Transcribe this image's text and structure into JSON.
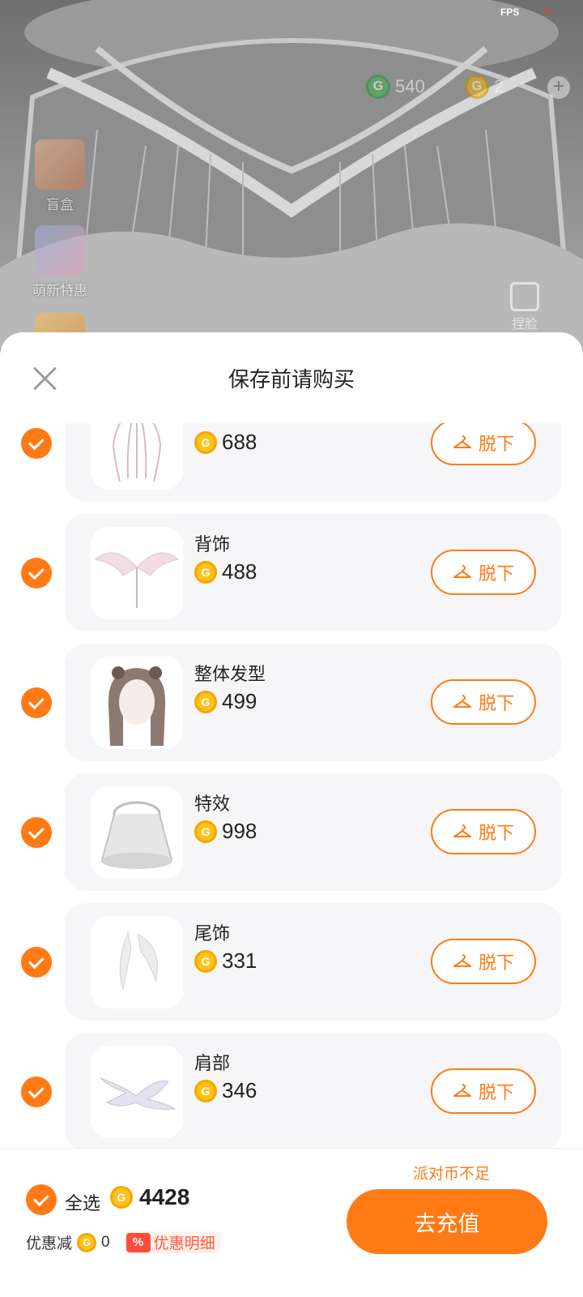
{
  "status": {
    "fps_label": "FPS",
    "fps_value": "7"
  },
  "hud": {
    "green_currency": {
      "icon": "green-coin-icon",
      "value": "540"
    },
    "gold_currency": {
      "icon": "gold-coin-icon",
      "value": "2"
    },
    "plus_symbol": "+"
  },
  "side_menu": {
    "blind_box_label": "盲盒",
    "special_offer_label": "萌新特惠",
    "right_tool_label": "捏脸"
  },
  "sheet": {
    "title": "保存前请购买",
    "items": [
      {
        "name": "",
        "price": "688",
        "action": "脱下",
        "thumb": "headdress"
      },
      {
        "name": "背饰",
        "price": "488",
        "action": "脱下",
        "thumb": "wings"
      },
      {
        "name": "整体发型",
        "price": "499",
        "action": "脱下",
        "thumb": "hair"
      },
      {
        "name": "特效",
        "price": "998",
        "action": "脱下",
        "thumb": "effect"
      },
      {
        "name": "尾饰",
        "price": "331",
        "action": "脱下",
        "thumb": "tail"
      },
      {
        "name": "肩部",
        "price": "346",
        "action": "脱下",
        "thumb": "shoulder"
      }
    ]
  },
  "footer": {
    "insufficient": "派对币不足",
    "select_all": "全选",
    "total": "4428",
    "discount_label": "优惠减",
    "discount_value": "0",
    "pct_symbol": "%",
    "detail_label": "优惠明细",
    "recharge": "去充值"
  },
  "colors": {
    "accent": "#ff7a14",
    "coin": "#ffc21a",
    "card_bg": "#f6f6f8"
  }
}
